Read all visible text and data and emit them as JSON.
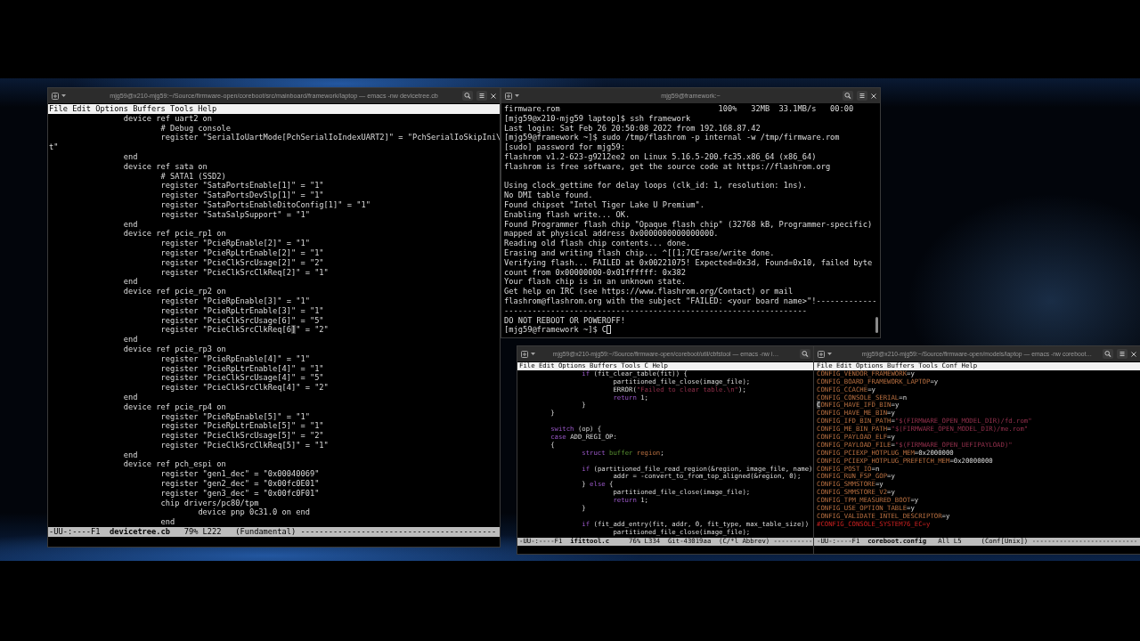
{
  "windows": [
    {
      "kind": "editor",
      "title": "mjg59@x210-mjg59:~/Source/firmware-open/coreboot/src/mainboard/framework/laptop — emacs -nw devicetree.cb",
      "covered": false,
      "menu": [
        "File",
        "Edit",
        "Options",
        "Buffers",
        "Tools",
        "Help"
      ],
      "blocks": [
        [
          "\t\tdevice ref uart2 on",
          "\t\t\t# Debug console",
          "\t\t\tregister \"SerialIoUartMode[PchSerialIoIndexUART2]\" = \"PchSerialIoSkipIni\\",
          "t\"",
          "\t\tend",
          "\t\tdevice ref sata on",
          "\t\t\t# SATA1 (SSD2)",
          "\t\t\tregister \"SataPortsEnable[1]\" = \"1\"",
          "\t\t\tregister \"SataPortsDevSlp[1]\" = \"1\"",
          "\t\t\tregister \"SataPortsEnableDitoConfig[1]\" = \"1\"",
          "\t\t\tregister \"SataSalpSupport\" = \"1\"",
          "\t\tend",
          "\t\tdevice ref pcie_rp1 on",
          "\t\t\tregister \"PcieRpEnable[2]\" = \"1\"",
          "\t\t\tregister \"PcieRpLtrEnable[2]\" = \"1\"",
          "\t\t\tregister \"PcieClkSrcUsage[2]\" = \"2\"",
          "\t\t\tregister \"PcieClkSrcClkReq[2]\" = \"1\"",
          "\t\tend",
          "\t\tdevice ref pcie_rp2 on",
          "\t\t\tregister \"PcieRpEnable[3]\" = \"1\"",
          "\t\t\tregister \"PcieRpLtrEnable[3]\" = \"1\"",
          "\t\t\tregister \"PcieClkSrcUsage[6]\" = \"5\"",
          [
            {
              "text": "\t\t\tregister \"PcieClkSrcClkReq[6",
              "kind": "plain"
            },
            {
              "text": "]",
              "kind": "cursor"
            },
            {
              "text": "\" = \"2\"",
              "kind": "plain"
            }
          ],
          "\t\tend",
          "\t\tdevice ref pcie_rp3 on",
          "\t\t\tregister \"PcieRpEnable[4]\" = \"1\"",
          "\t\t\tregister \"PcieRpLtrEnable[4]\" = \"1\"",
          "\t\t\tregister \"PcieClkSrcUsage[4]\" = \"5\"",
          "\t\t\tregister \"PcieClkSrcClkReq[4]\" = \"2\"",
          "\t\tend",
          "\t\tdevice ref pcie_rp4 on",
          "\t\t\tregister \"PcieRpEnable[5]\" = \"1\"",
          "\t\t\tregister \"PcieRpLtrEnable[5]\" = \"1\"",
          "\t\t\tregister \"PcieClkSrcUsage[5]\" = \"2\"",
          "\t\t\tregister \"PcieClkSrcClkReq[5]\" = \"1\"",
          "\t\tend",
          "\t\tdevice ref pch_espi on",
          "\t\t\tregister \"gen1_dec\" = \"0x00040069\"",
          "\t\t\tregister \"gen2_dec\" = \"0x00fc0E01\"",
          "\t\t\tregister \"gen3_dec\" = \"0x00fc0F01\"",
          "\t\t\tchip drivers/pc80/tpm",
          "\t\t\t\tdevice pnp 0c31.0 on end",
          "\t\t\tend"
        ]
      ],
      "mode_line": [
        {
          "text": "-UU-:----F1  ",
          "kind": "plain"
        },
        {
          "text": "devicetree.cb",
          "kind": "buffer"
        },
        {
          "text": "   79% L222   (Fundamental) ------------------------------------------",
          "kind": "plain"
        }
      ]
    },
    {
      "kind": "terminal",
      "title": "mjg59@framework:~",
      "covered": false,
      "cursor": true,
      "blocks": [
        [
          "firmware.rom                                  100%   32MB  33.1MB/s   00:00",
          "[mjg59@x210-mjg59 laptop]$ ssh framework",
          "Last login: Sat Feb 26 20:50:08 2022 from 192.168.87.42",
          "[mjg59@framework ~]$ sudo /tmp/flashrom -p internal -w /tmp/firmware.rom",
          "[sudo] password for mjg59:",
          "flashrom v1.2-623-g9212ee2 on Linux 5.16.5-200.fc35.x86_64 (x86_64)",
          "flashrom is free software, get the source code at https://flashrom.org"
        ],
        [
          "Using clock_gettime for delay loops (clk_id: 1, resolution: 1ns).",
          "No DMI table found.",
          "Found chipset \"Intel Tiger Lake U Premium\".",
          "Enabling flash write... OK.",
          "Found Programmer flash chip \"Opaque flash chip\" (32768 kB, Programmer-specific)",
          "mapped at physical address 0x0000000000000000.",
          "Reading old flash chip contents... done.",
          "Erasing and writing flash chip... ^[[1;7CErase/write done.",
          "Verifying flash... FAILED at 0x00221075! Expected=0x3d, Found=0x10, failed byte",
          "count from 0x00000000-0x01ffffff: 0x382",
          "Your flash chip is in an unknown state.",
          "Get help on IRC (see https://www.flashrom.org/Contact) or mail",
          "flashrom@flashrom.org with the subject \"FAILED: <your board name>\"!-------------",
          "-----------------------------------------------------------------",
          "DO NOT REBOOT OR POWEROFF!",
          "[mjg59@framework ~]$ C"
        ]
      ]
    },
    {
      "kind": "editor",
      "title": "mjg59@x210-mjg59:~/Source/firmware-open/coreboot/util/cbfstool — emacs -nw i…",
      "covered": true,
      "menu": [
        "File",
        "Edit",
        "Options",
        "Buffers",
        "Tools",
        "C",
        "Help"
      ],
      "blocks": [
        [
          [
            {
              "text": "\t\tif",
              "kind": "keyword"
            },
            {
              "text": " (fit_clear_table(fit)) {",
              "kind": "plain"
            }
          ],
          [
            {
              "text": "\t\t\tpartitioned_file_close(image_file);",
              "kind": "plain"
            }
          ],
          [
            {
              "text": "\t\t\tERROR(",
              "kind": "plain"
            },
            {
              "text": "\"Failed to clear table.\\n\"",
              "kind": "string"
            },
            {
              "text": ");",
              "kind": "plain"
            }
          ],
          [
            {
              "text": "\t\t\treturn",
              "kind": "keyword"
            },
            {
              "text": " 1;",
              "kind": "plain"
            }
          ],
          [
            {
              "text": "\t\t}",
              "kind": "plain"
            }
          ],
          [
            {
              "text": "\t}",
              "kind": "plain"
            }
          ]
        ],
        [
          [
            {
              "text": "\tswitch",
              "kind": "keyword"
            },
            {
              "text": " (op) {",
              "kind": "plain"
            }
          ],
          [
            {
              "text": "\tcase",
              "kind": "keyword"
            },
            {
              "text": " ADD_REGI_OP:",
              "kind": "plain"
            }
          ],
          [
            {
              "text": "\t{",
              "kind": "plain"
            }
          ],
          [
            {
              "text": "\t\tstruct ",
              "kind": "keyword"
            },
            {
              "text": "buffer ",
              "kind": "type"
            },
            {
              "text": "region",
              "kind": "variable"
            },
            {
              "text": ";",
              "kind": "plain"
            }
          ]
        ],
        [
          [
            {
              "text": "\t\tif",
              "kind": "keyword"
            },
            {
              "text": " (partitioned_file_read_region(&region, image_file, name)",
              "kind": "plain"
            }
          ],
          [
            {
              "text": "\t\t\taddr = -convert_to_from_top_aligned(&region, 0);",
              "kind": "plain"
            }
          ],
          [
            {
              "text": "\t\t} ",
              "kind": "plain"
            },
            {
              "text": "else",
              "kind": "keyword"
            },
            {
              "text": " {",
              "kind": "plain"
            }
          ],
          [
            {
              "text": "\t\t\tpartitioned_file_close(image_file);",
              "kind": "plain"
            }
          ],
          [
            {
              "text": "\t\t\treturn",
              "kind": "keyword"
            },
            {
              "text": " 1;",
              "kind": "plain"
            }
          ],
          [
            {
              "text": "\t\t}",
              "kind": "plain"
            }
          ]
        ],
        [
          [
            {
              "text": "\t\tif",
              "kind": "keyword"
            },
            {
              "text": " (fit_add_entry(fit, addr, 0, fit_type, max_table_size))",
              "kind": "plain"
            }
          ],
          [
            {
              "text": "\t\t\tpartitioned_file_close(image_file);",
              "kind": "plain"
            }
          ]
        ]
      ],
      "mode_line": [
        {
          "text": "-UU-:----F1  ",
          "kind": "plain"
        },
        {
          "text": "ifittool.c",
          "kind": "buffer"
        },
        {
          "text": "     76% L334  Git-43019aa  (C/*l Abbrev) ----------",
          "kind": "plain"
        }
      ]
    },
    {
      "kind": "editor",
      "title": "mjg59@x210-mjg59:~/Source/firmware-open/models/laptop — emacs -nw coreboot…",
      "covered": false,
      "menu": [
        "File",
        "Edit",
        "Options",
        "Buffers",
        "Tools",
        "Conf",
        "Help"
      ],
      "blocks": [
        [
          [
            {
              "text": "CONFIG_VENDOR_FRAMEWORK",
              "kind": "variable"
            },
            {
              "text": "=y",
              "kind": "plain"
            }
          ],
          [
            {
              "text": "CONFIG_BOARD_FRAMEWORK_LAPTOP",
              "kind": "variable"
            },
            {
              "text": "=y",
              "kind": "plain"
            }
          ],
          [
            {
              "text": "CONFIG_CCACHE",
              "kind": "variable"
            },
            {
              "text": "=y",
              "kind": "plain"
            }
          ],
          [
            {
              "text": "CONFIG_CONSOLE_SERIAL",
              "kind": "variable"
            },
            {
              "text": "=n",
              "kind": "plain"
            }
          ],
          [
            {
              "text": "C",
              "kind": "cursor"
            },
            {
              "text": "ONFIG_HAVE_IFD_BIN",
              "kind": "variable"
            },
            {
              "text": "=y",
              "kind": "plain"
            }
          ],
          [
            {
              "text": "CONFIG_HAVE_ME_BIN",
              "kind": "variable"
            },
            {
              "text": "=y",
              "kind": "plain"
            }
          ],
          [
            {
              "text": "CONFIG_IFD_BIN_PATH",
              "kind": "variable"
            },
            {
              "text": "=",
              "kind": "plain"
            },
            {
              "text": "\"$(FIRMWARE_OPEN_MODEL_DIR)/fd.rom\"",
              "kind": "string"
            }
          ],
          [
            {
              "text": "CONFIG_ME_BIN_PATH",
              "kind": "variable"
            },
            {
              "text": "=",
              "kind": "plain"
            },
            {
              "text": "\"$(FIRMWARE_OPEN_MODEL_DIR)/me.rom\"",
              "kind": "string"
            }
          ],
          [
            {
              "text": "CONFIG_PAYLOAD_ELF",
              "kind": "variable"
            },
            {
              "text": "=y",
              "kind": "plain"
            }
          ],
          [
            {
              "text": "CONFIG_PAYLOAD_FILE",
              "kind": "variable"
            },
            {
              "text": "=",
              "kind": "plain"
            },
            {
              "text": "\"$(FIRMWARE_OPEN_UEFIPAYLOAD)\"",
              "kind": "string"
            }
          ],
          [
            {
              "text": "CONFIG_PCIEXP_HOTPLUG_MEM",
              "kind": "variable"
            },
            {
              "text": "=0x2000000",
              "kind": "plain"
            }
          ],
          [
            {
              "text": "CONFIG_PCIEXP_HOTPLUG_PREFETCH_MEM",
              "kind": "variable"
            },
            {
              "text": "=0x20000000",
              "kind": "plain"
            }
          ],
          [
            {
              "text": "CONFIG_POST_IO",
              "kind": "variable"
            },
            {
              "text": "=n",
              "kind": "plain"
            }
          ],
          [
            {
              "text": "CONFIG_RUN_FSP_GOP",
              "kind": "variable"
            },
            {
              "text": "=y",
              "kind": "plain"
            }
          ],
          [
            {
              "text": "CONFIG_SMMSTORE",
              "kind": "variable"
            },
            {
              "text": "=y",
              "kind": "plain"
            }
          ],
          [
            {
              "text": "CONFIG_SMMSTORE_V2",
              "kind": "variable"
            },
            {
              "text": "=y",
              "kind": "plain"
            }
          ],
          [
            {
              "text": "CONFIG_TPM_MEASURED_BOOT",
              "kind": "variable"
            },
            {
              "text": "=y",
              "kind": "plain"
            }
          ],
          [
            {
              "text": "CONFIG_USE_OPTION_TABLE",
              "kind": "variable"
            },
            {
              "text": "=y",
              "kind": "plain"
            }
          ],
          [
            {
              "text": "CONFIG_VALIDATE_INTEL_DESCRIPTOR",
              "kind": "variable"
            },
            {
              "text": "=y",
              "kind": "plain"
            }
          ],
          [
            {
              "text": "#CONFIG_CONSOLE_SYSTEM76_EC=y",
              "kind": "comment"
            }
          ]
        ]
      ],
      "mode_line": [
        {
          "text": "-UU-:----F1  ",
          "kind": "plain"
        },
        {
          "text": "coreboot.config",
          "kind": "buffer"
        },
        {
          "text": "   All L5     (Conf[Unix]) ---------------------------",
          "kind": "plain"
        }
      ]
    }
  ]
}
